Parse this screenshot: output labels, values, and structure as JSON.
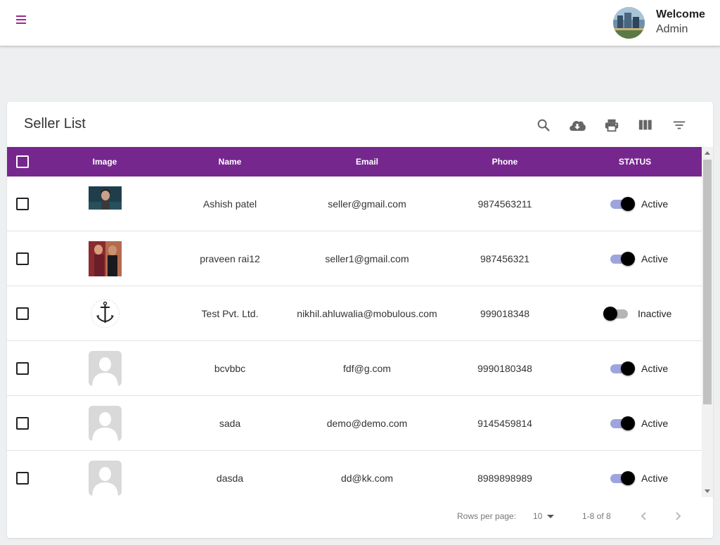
{
  "header": {
    "welcome": "Welcome",
    "user": "Admin",
    "menu_icon": "hamburger-menu-icon",
    "accent": "#9c2a8e"
  },
  "card": {
    "title": "Seller List",
    "tools": [
      "search-icon",
      "cloud-download-icon",
      "print-icon",
      "view-columns-icon",
      "filter-list-icon"
    ]
  },
  "table": {
    "header_color": "#76278e",
    "columns": [
      "Image",
      "Name",
      "Email",
      "Phone",
      "STATUS"
    ],
    "rows": [
      {
        "image": "photo",
        "name": "Ashish patel",
        "email": "seller@gmail.com",
        "phone": "9874563211",
        "active": true,
        "status": "Active"
      },
      {
        "image": "photo",
        "name": "praveen rai12",
        "email": "seller1@gmail.com",
        "phone": "987456321",
        "active": true,
        "status": "Active"
      },
      {
        "image": "logo",
        "name": "Test Pvt. Ltd.",
        "email": "nikhil.ahluwalia@mobulous.com",
        "phone": "999018348",
        "active": false,
        "status": "Inactive"
      },
      {
        "image": "placeholder",
        "name": "bcvbbc",
        "email": "fdf@g.com",
        "phone": "9990180348",
        "active": true,
        "status": "Active"
      },
      {
        "image": "placeholder",
        "name": "sada",
        "email": "demo@demo.com",
        "phone": "9145459814",
        "active": true,
        "status": "Active"
      },
      {
        "image": "placeholder",
        "name": "dasda",
        "email": "dd@kk.com",
        "phone": "8989898989",
        "active": true,
        "status": "Active"
      }
    ]
  },
  "footer": {
    "rows_per_page_label": "Rows per page:",
    "rows_per_page_value": "10",
    "range": "1-8 of 8"
  }
}
